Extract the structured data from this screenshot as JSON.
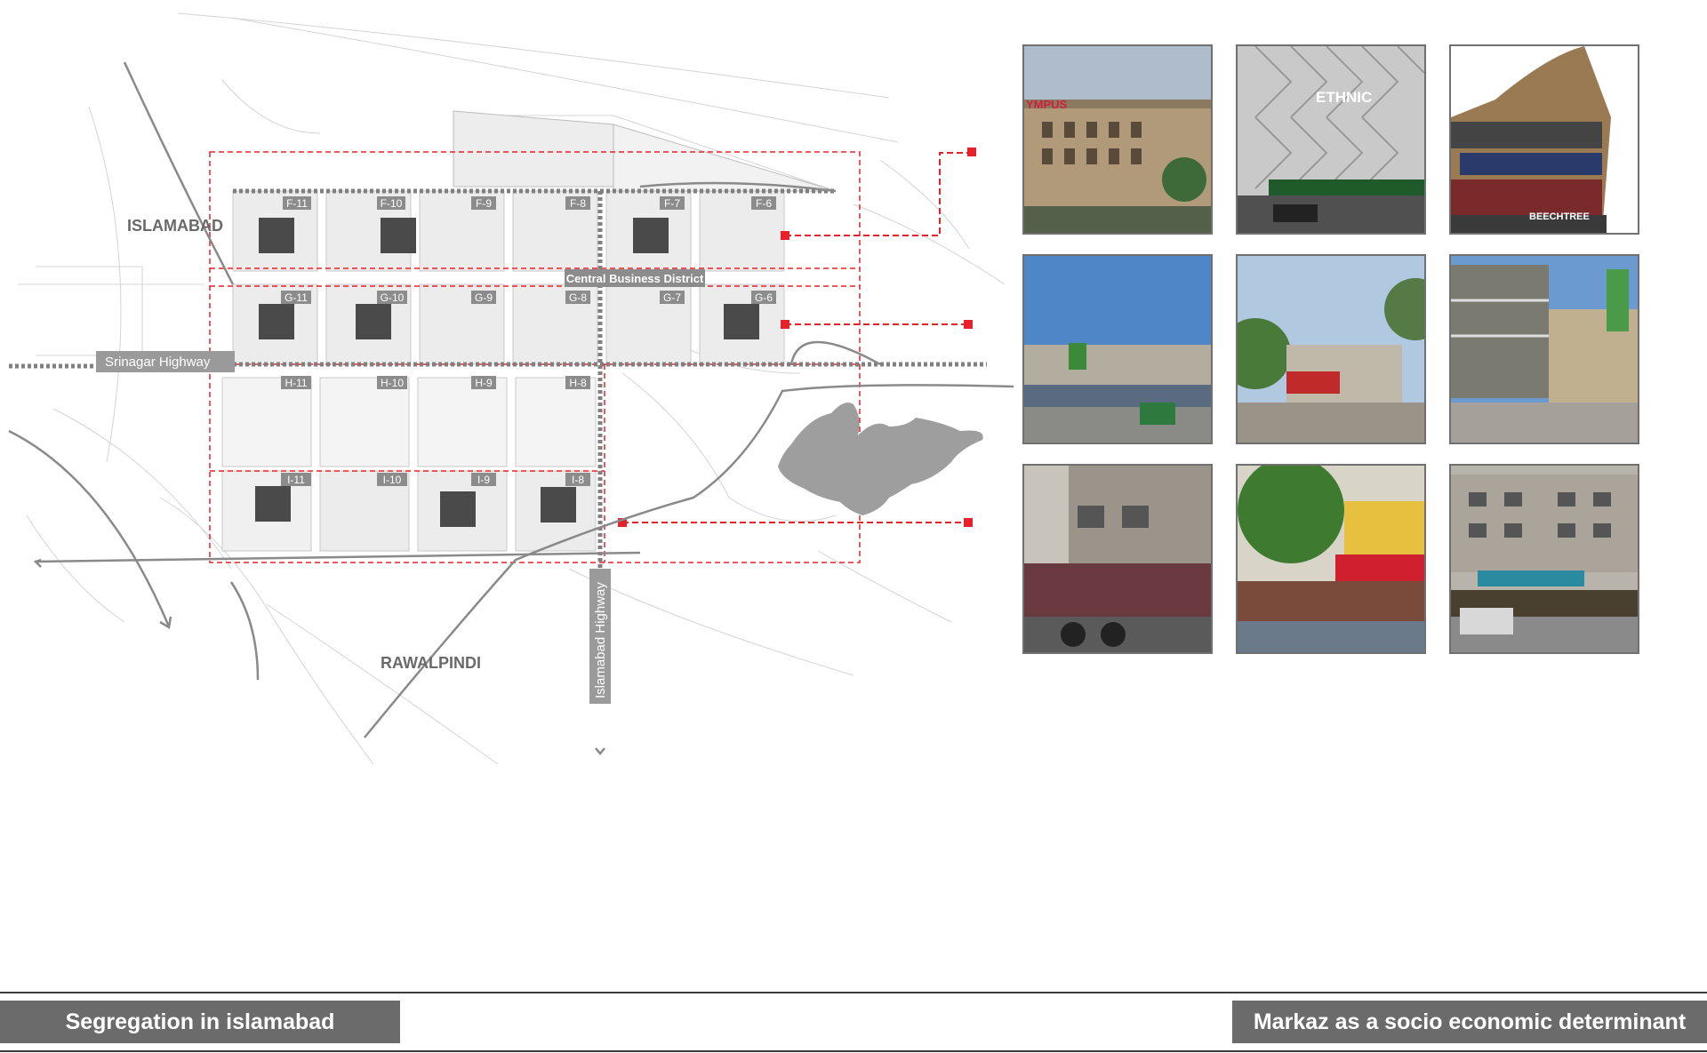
{
  "map": {
    "city_north": "ISLAMABAD",
    "city_south": "RAWALPINDI",
    "highway_west": "Srinagar Highway",
    "highway_south": "Islamabad Highway",
    "cbd_label": "Central Business District",
    "sectors_f": [
      "F-11",
      "F-10",
      "F-9",
      "F-8",
      "F-7",
      "F-6"
    ],
    "sectors_g": [
      "G-11",
      "G-10",
      "G-9",
      "G-8",
      "G-7",
      "G-6"
    ],
    "sectors_h": [
      "H-11",
      "H-10",
      "H-9",
      "H-8"
    ],
    "sectors_i": [
      "I-11",
      "I-10",
      "I-9",
      "I-8"
    ],
    "accent_color": "#e8202a",
    "markaz_color": "#4a4a4a",
    "lake_color": "#9e9e9e"
  },
  "photos": [
    {
      "sign": "YMPUS",
      "subject": "mall building"
    },
    {
      "sign": "ETHNIC",
      "subject": "retail facade"
    },
    {
      "sign": "BEECHTREE",
      "subject": "shop signage"
    },
    {
      "sign": "",
      "subject": "market street"
    },
    {
      "sign": "",
      "subject": "market square"
    },
    {
      "sign": "",
      "subject": "plaza street"
    },
    {
      "sign": "",
      "subject": "busy street"
    },
    {
      "sign": "",
      "subject": "shop front"
    },
    {
      "sign": "",
      "subject": "plaza building"
    }
  ],
  "footer": {
    "left_title": "Segregation in islamabad",
    "right_title": "Markaz as a socio economic determinant"
  }
}
